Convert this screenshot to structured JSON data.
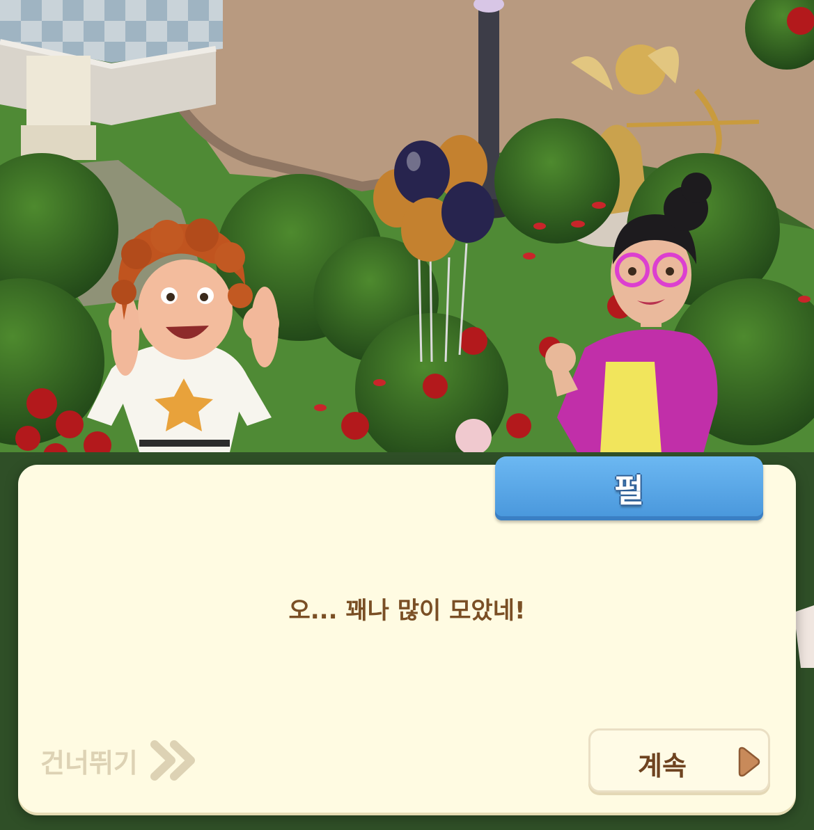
{
  "dialog": {
    "speaker": "펄",
    "text": "오... 꽤나 많이 모았네!"
  },
  "controls": {
    "skip_label": "건너뛰기",
    "continue_label": "계속"
  },
  "icons": {
    "skip": "double-chevron-right-icon",
    "continue": "play-triangle-icon"
  },
  "colors": {
    "dialog_bg": "#fffbe2",
    "speaker_tab": "#4a98dc",
    "text": "#7a4f25",
    "skip": "#ddd2b4",
    "continue_icon": "#c88a5a"
  }
}
